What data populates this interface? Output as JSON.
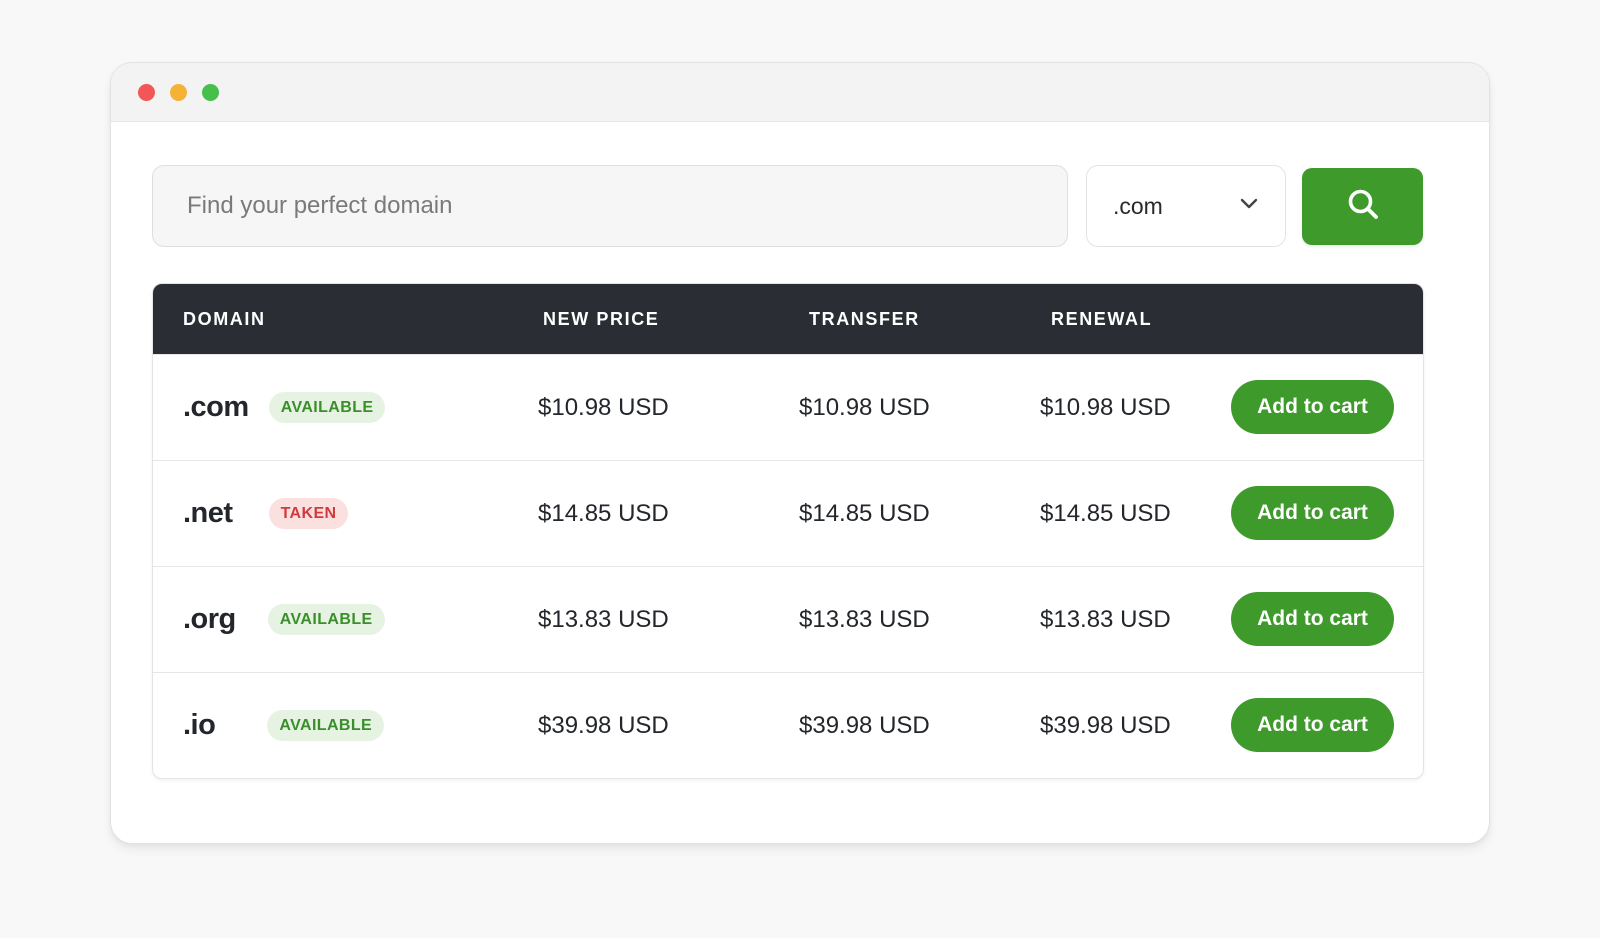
{
  "colors": {
    "accent": "#3e9a2b",
    "header_bg": "#2a2e34",
    "available_bg": "#e6f3e2",
    "available_text": "#3a8f2b",
    "taken_bg": "#fbe0e0",
    "taken_text": "#d23b3b"
  },
  "window_controls": [
    "close",
    "minimize",
    "maximize"
  ],
  "search": {
    "placeholder": "Find your perfect domain",
    "value": "",
    "tld_selected": ".com",
    "tld_icon": "chevron-down-icon",
    "button_icon": "search-icon"
  },
  "table": {
    "headers": {
      "domain": "DOMAIN",
      "new_price": "NEW PRICE",
      "transfer": "TRANSFER",
      "renewal": "RENEWAL"
    },
    "rows": [
      {
        "tld": ".com",
        "status": "AVAILABLE",
        "new_price": "$10.98 USD",
        "transfer": "$10.98 USD",
        "renewal": "$10.98 USD",
        "action": "Add to cart"
      },
      {
        "tld": ".net",
        "status": "TAKEN",
        "new_price": "$14.85 USD",
        "transfer": "$14.85 USD",
        "renewal": "$14.85 USD",
        "action": "Add to cart"
      },
      {
        "tld": ".org",
        "status": "AVAILABLE",
        "new_price": "$13.83 USD",
        "transfer": "$13.83 USD",
        "renewal": "$13.83 USD",
        "action": "Add to cart"
      },
      {
        "tld": ".io",
        "status": "AVAILABLE",
        "new_price": "$39.98 USD",
        "transfer": "$39.98 USD",
        "renewal": "$39.98 USD",
        "action": "Add to cart"
      }
    ]
  }
}
